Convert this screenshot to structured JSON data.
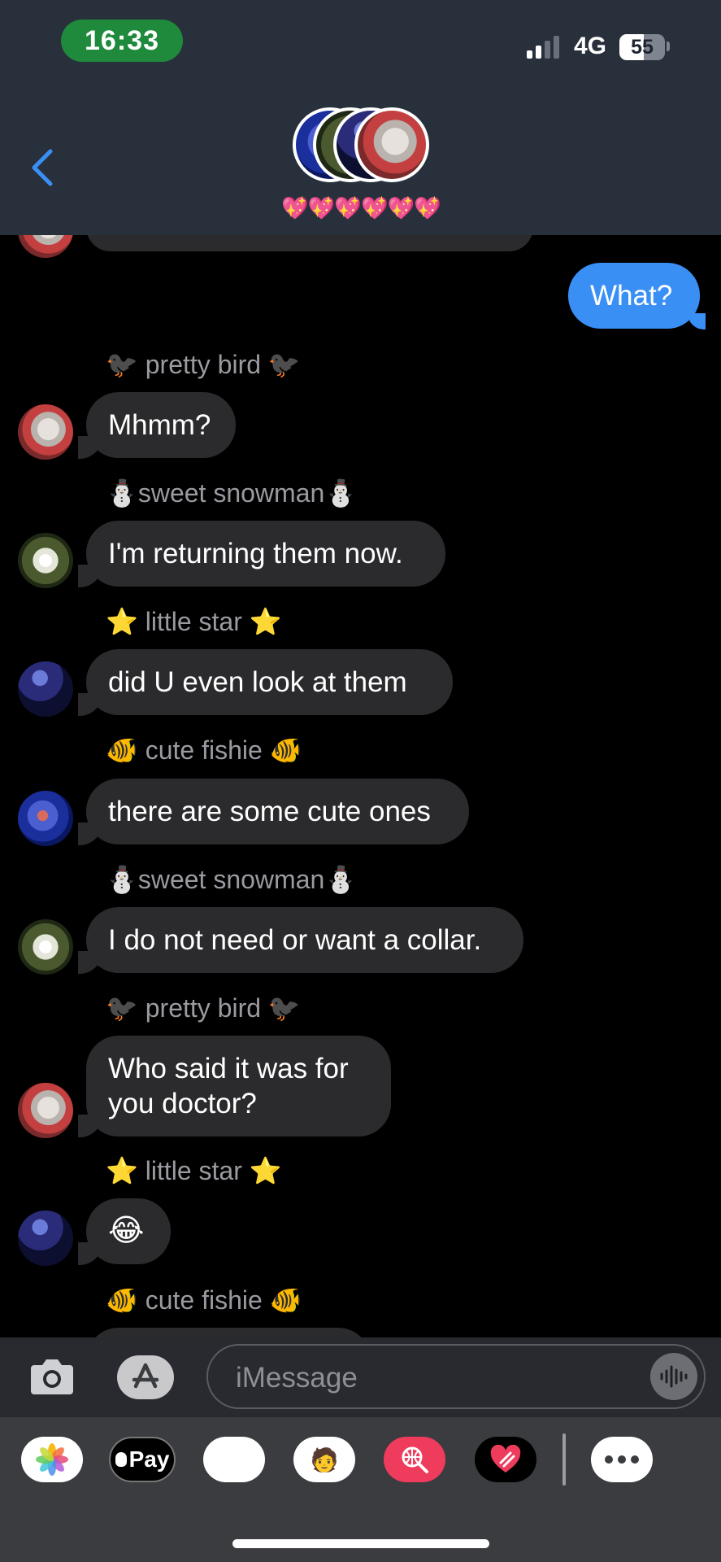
{
  "status_bar": {
    "time": "16:33",
    "network": "4G",
    "battery": "55"
  },
  "header": {
    "hearts": "💖💖💖💖💖💖"
  },
  "messages": [
    {
      "type": "outgoing",
      "text": "What?"
    },
    {
      "type": "sender",
      "text": "🐦‍⬛ pretty bird 🐦‍⬛"
    },
    {
      "type": "incoming",
      "text": "Mhmm?",
      "avatar": "cat"
    },
    {
      "type": "sender",
      "text": "⛄sweet snowman⛄"
    },
    {
      "type": "incoming",
      "text": "I'm returning them now.",
      "avatar": "flower"
    },
    {
      "type": "sender",
      "text": "⭐ little star ⭐"
    },
    {
      "type": "incoming",
      "text": "did U even look at them",
      "avatar": "night-sky"
    },
    {
      "type": "sender",
      "text": "🐠 cute fishie 🐠"
    },
    {
      "type": "incoming",
      "text": "there are some cute ones",
      "avatar": "fish"
    },
    {
      "type": "sender",
      "text": "⛄sweet snowman⛄"
    },
    {
      "type": "incoming",
      "text": "I do not need or want a collar.",
      "avatar": "flower"
    },
    {
      "type": "sender",
      "text": "🐦‍⬛ pretty bird 🐦‍⬛"
    },
    {
      "type": "incoming",
      "text_line1": "Who said it was for",
      "text_line2": "you doctor?",
      "avatar": "cat"
    },
    {
      "type": "sender",
      "text": "⭐ little star ⭐"
    },
    {
      "type": "incoming",
      "text": "😂",
      "avatar": "night-sky"
    },
    {
      "type": "sender",
      "text": "🐠 cute fishie 🐠"
    }
  ],
  "input": {
    "placeholder": "iMessage"
  },
  "app_drawer": {
    "apple_pay": "Pay"
  }
}
